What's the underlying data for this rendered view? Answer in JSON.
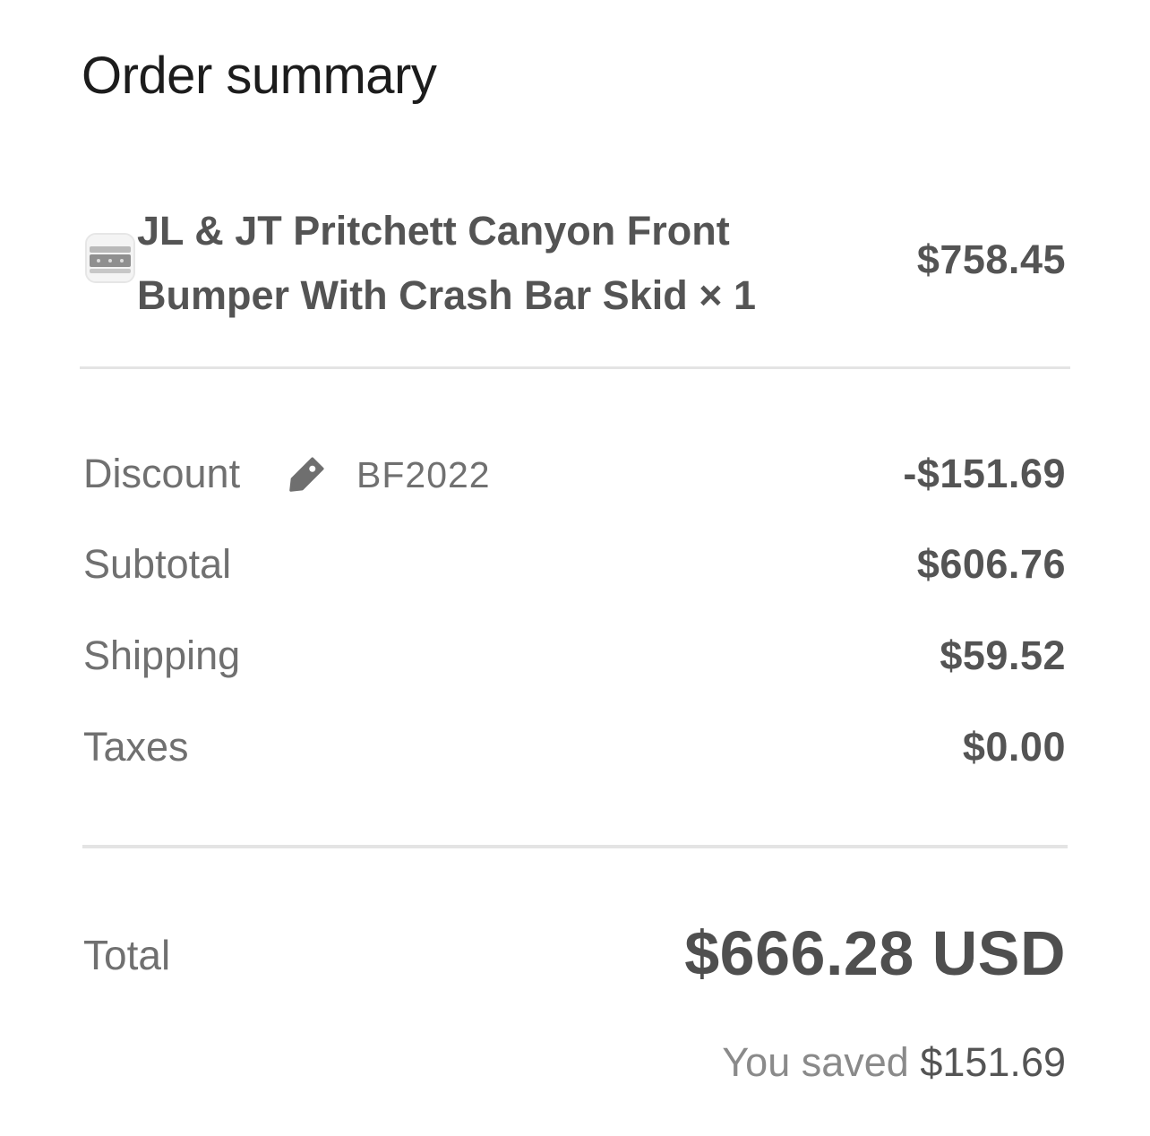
{
  "header": {
    "title": "Order summary"
  },
  "product": {
    "name_line1": "JL & JT Pritchett Canyon Front",
    "name_line2": "Bumper With Crash Bar Skid × 1",
    "price": "$758.45",
    "thumbnail_icon": "bumper-thumbnail"
  },
  "summary": {
    "discount": {
      "label": "Discount",
      "icon": "tag-icon",
      "code": "BF2022",
      "value": "-$151.69"
    },
    "subtotal": {
      "label": "Subtotal",
      "value": "$606.76"
    },
    "shipping": {
      "label": "Shipping",
      "value": "$59.52"
    },
    "taxes": {
      "label": "Taxes",
      "value": "$0.00"
    }
  },
  "total": {
    "label": "Total",
    "value": "$666.28 USD"
  },
  "savings": {
    "label": "You saved",
    "amount": "$151.69"
  },
  "colors": {
    "text_primary": "#1c1c1c",
    "text_strong": "#545454",
    "text_muted": "#707070",
    "divider": "#e4e4e4",
    "tag_icon": "#6f6f6f"
  }
}
